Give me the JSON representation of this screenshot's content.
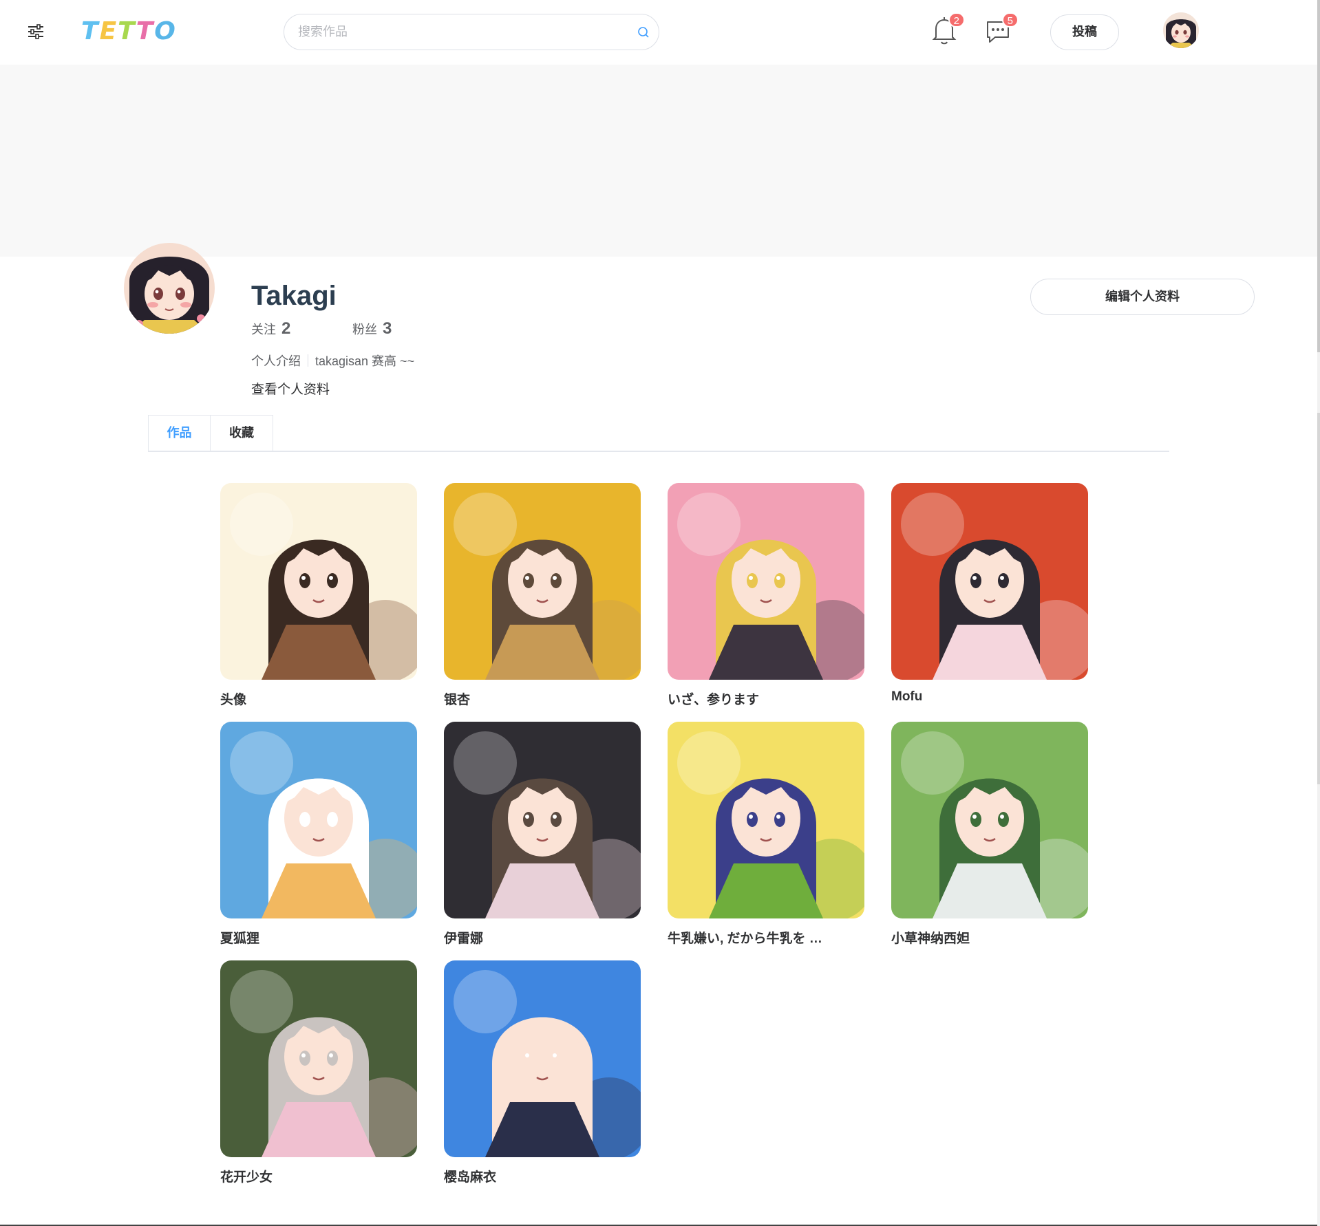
{
  "header": {
    "logo_letters": [
      "T",
      "E",
      "T",
      "T",
      "O"
    ],
    "logo_colors": [
      "#5fc0f0",
      "#f6c544",
      "#a8d84e",
      "#e86fa8",
      "#58b6e8"
    ],
    "search_placeholder": "搜索作品",
    "notifications_count": "2",
    "messages_count": "5",
    "post_label": "投稿"
  },
  "profile": {
    "name": "Takagi",
    "following_label": "关注",
    "following_count": "2",
    "followers_label": "粉丝",
    "followers_count": "3",
    "bio_label": "个人介绍",
    "bio_text": "takagisan 赛高 ~~",
    "view_profile_label": "查看个人资料",
    "edit_profile_label": "编辑个人资料"
  },
  "tabs": [
    {
      "label": "作品",
      "active": true
    },
    {
      "label": "收藏",
      "active": false
    }
  ],
  "works": [
    {
      "title": "头像",
      "palette": [
        "#fbf3de",
        "#8a5a3c",
        "#3a2a22"
      ]
    },
    {
      "title": "银杏",
      "palette": [
        "#e8b52c",
        "#c79a55",
        "#5e4a3a"
      ]
    },
    {
      "title": "いざ、参ります",
      "palette": [
        "#f2a0b5",
        "#3d3440",
        "#e9c64f"
      ]
    },
    {
      "title": "Mofu",
      "palette": [
        "#d94a2e",
        "#f5d6dd",
        "#2e2a33"
      ]
    },
    {
      "title": "夏狐狸",
      "palette": [
        "#5fa8e0",
        "#f2b860",
        "#ffffff"
      ]
    },
    {
      "title": "伊雷娜",
      "palette": [
        "#2f2d33",
        "#e8d0d8",
        "#5a4a40"
      ]
    },
    {
      "title": "牛乳嫌い, だから牛乳を …",
      "palette": [
        "#f3e065",
        "#6fae3c",
        "#3b3f8a"
      ]
    },
    {
      "title": "小草神纳西妲",
      "palette": [
        "#7fb55c",
        "#e7ecea",
        "#3e6e3a"
      ]
    },
    {
      "title": "花开少女",
      "palette": [
        "#4a5e3a",
        "#f0c0d0",
        "#c9c3c0"
      ]
    },
    {
      "title": "樱岛麻衣",
      "palette": [
        "#3f86e0",
        "#2a2f4a",
        "#fbe3d6"
      ]
    }
  ]
}
